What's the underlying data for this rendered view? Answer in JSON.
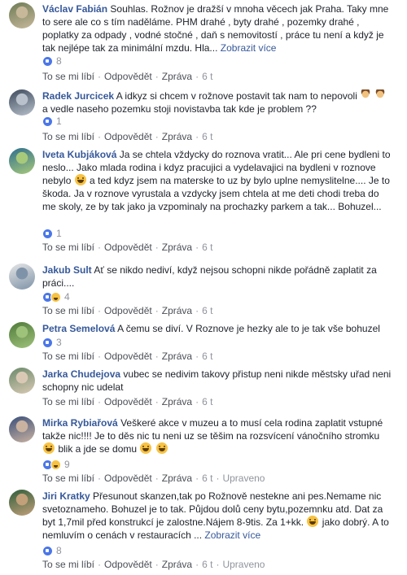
{
  "comments": [
    {
      "author": "Václav Fabián",
      "segments": [
        {
          "t": "text",
          "v": "Souhlas. Rožnov je dražší v mnoha věcech jak Praha. Taky mne to sere ale co s tím naděláme. PHM drahé , byty drahé , pozemky drahé , poplatky za odpady , vodné stočné , daň s nemovitostí , práce tu není a když je tak nejlépe tak za minimální mzdu. Hla... "
        },
        {
          "t": "more",
          "v": "Zobrazit více"
        }
      ],
      "reactions": {
        "types": [
          "like"
        ],
        "count": "8"
      },
      "actions": {
        "like": "To se mi líbí",
        "reply": "Odpovědět",
        "share": "Zpráva",
        "time": "6 t",
        "edited": ""
      },
      "avatar": {
        "bg1": "#6d7b55",
        "bg2": "#c7b89a"
      }
    },
    {
      "author": "Radek Jurcicek",
      "segments": [
        {
          "t": "text",
          "v": "A idkyz si chcem v rožnove postavit tak nam to nepovoli "
        },
        {
          "t": "emoji",
          "v": "person-facepalming"
        },
        {
          "t": "text",
          "v": " "
        },
        {
          "t": "emoji",
          "v": "person-shrugging"
        },
        {
          "t": "text",
          "v": " a vedle naseho pozemku stoji novistavba tak kde je problem ??"
        }
      ],
      "reactions": {
        "types": [
          "like"
        ],
        "count": "1"
      },
      "actions": {
        "like": "To se mi líbí",
        "reply": "Odpovědět",
        "share": "Zpráva",
        "time": "6 t",
        "edited": ""
      },
      "avatar": {
        "bg1": "#3d4a5c",
        "bg2": "#b8c1cc"
      }
    },
    {
      "author": "Iveta Kubjáková",
      "segments": [
        {
          "t": "text",
          "v": "Ja se chtela vždycky do roznova vratit... Ale pri cene bydleni to neslo... Jako mlada rodina i kdyz pracujici a vydelavajici na bydleni v roznove nebylo "
        },
        {
          "t": "emoji",
          "v": "confused-face"
        },
        {
          "t": "text",
          "v": " a ted kdyz jsem na materske to uz by bylo uplne nemyslitelne.... Je to škoda. Ja v roznove vyrustala a vzdycky jsem chtela at me deti chodi treba do me skoly, ze by tak jako ja vzpominaly na prochazky parkem a tak... Bohuzel..."
        }
      ],
      "reactions": {
        "types": [
          "like"
        ],
        "count": "1"
      },
      "actions": {
        "like": "To se mi líbí",
        "reply": "Odpovědět",
        "share": "Zpráva",
        "time": "6 t",
        "edited": ""
      },
      "avatar": {
        "bg1": "#2f6f8f",
        "bg2": "#a7c97a"
      }
    },
    {
      "author": "Jakub Sult",
      "segments": [
        {
          "t": "text",
          "v": "Ať se nikdo nediví, když nejsou schopni nikde pořádně zaplatit za práci...."
        }
      ],
      "reactions": {
        "types": [
          "like",
          "haha"
        ],
        "count": "4"
      },
      "actions": {
        "like": "To se mi líbí",
        "reply": "Odpovědět",
        "share": "Zpráva",
        "time": "6 t",
        "edited": ""
      },
      "avatar": {
        "bg1": "#e6e6e6",
        "bg2": "#7f93a8"
      }
    },
    {
      "author": "Petra Semelová",
      "segments": [
        {
          "t": "text",
          "v": "A čemu se diví. V Roznove je hezky ale to je tak vše bohuzel"
        }
      ],
      "reactions": {
        "types": [
          "like"
        ],
        "count": "3"
      },
      "actions": {
        "like": "To se mi líbí",
        "reply": "Odpovědět",
        "share": "Zpráva",
        "time": "6 t",
        "edited": ""
      },
      "avatar": {
        "bg1": "#4f7a3a",
        "bg2": "#9fc27b"
      }
    },
    {
      "author": "Jarka Chudejova",
      "segments": [
        {
          "t": "text",
          "v": "vubec se nedivim takovy přistup neni nikde městsky uřad neni schopny nic udelat"
        }
      ],
      "reactions": {
        "types": [],
        "count": ""
      },
      "actions": {
        "like": "To se mi líbí",
        "reply": "Odpovědět",
        "share": "Zpráva",
        "time": "6 t",
        "edited": ""
      },
      "avatar": {
        "bg1": "#6b8a6a",
        "bg2": "#d9c9b4"
      }
    },
    {
      "author": "Mirka Rybiařová",
      "segments": [
        {
          "t": "text",
          "v": "Veškeré akce v muzeu a to musí cela rodina zaplatit vstupné takže nic!!!! Je to děs nic tu neni uz se těšim na rozsvícení vánočního stromku "
        },
        {
          "t": "emoji",
          "v": "grinning-face"
        },
        {
          "t": "text",
          "v": " blik a jde se domu "
        },
        {
          "t": "emoji",
          "v": "grinning-face"
        },
        {
          "t": "text",
          "v": " "
        },
        {
          "t": "emoji",
          "v": "grinning-face"
        }
      ],
      "reactions": {
        "types": [
          "like",
          "haha"
        ],
        "count": "9"
      },
      "actions": {
        "like": "To se mi líbí",
        "reply": "Odpovědět",
        "share": "Zpráva",
        "time": "6 t",
        "edited": "Upraveno"
      },
      "avatar": {
        "bg1": "#3a4f7a",
        "bg2": "#c9b2a0"
      }
    },
    {
      "author": "Jiri Kratky",
      "segments": [
        {
          "t": "text",
          "v": "Přesunout skanzen,tak po Rožnově nestekne ani pes.Nemame nic svetoznameho. Bohuzel je to tak. Půjdou dolů ceny bytu,pozemnku atd. Dat za byt 1,7mil před konstrukcí je zalostne.Nájem 8-9tis. Za 1+kk. "
        },
        {
          "t": "emoji",
          "v": "grinning-face"
        },
        {
          "t": "text",
          "v": " jako dobrý. A to nemluvím o cenách v restauracích ... "
        },
        {
          "t": "more",
          "v": "Zobrazit více"
        }
      ],
      "reactions": {
        "types": [
          "like"
        ],
        "count": "8"
      },
      "actions": {
        "like": "To se mi líbí",
        "reply": "Odpovědět",
        "share": "Zpráva",
        "time": "6 t",
        "edited": "Upraveno"
      },
      "avatar": {
        "bg1": "#2e5d3a",
        "bg2": "#c2a07a"
      }
    }
  ]
}
